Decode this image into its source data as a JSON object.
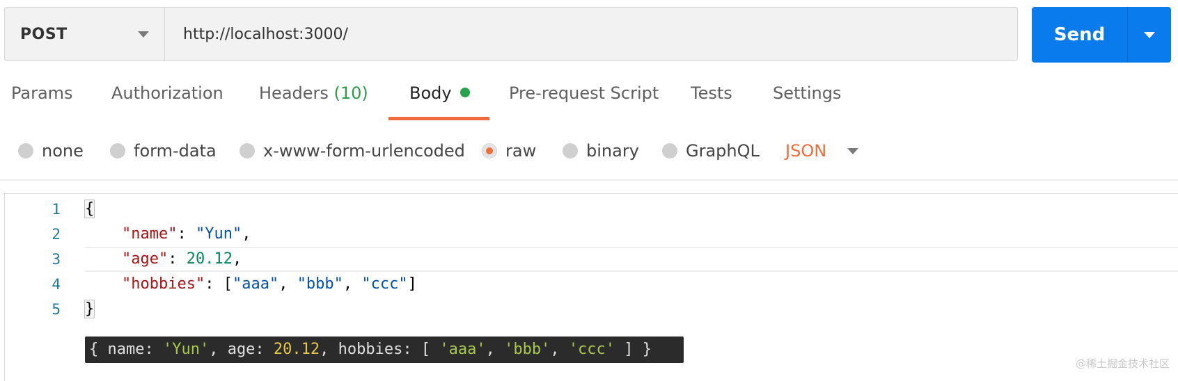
{
  "request": {
    "method": "POST",
    "url": "http://localhost:3000/",
    "send_label": "Send"
  },
  "tabs": [
    {
      "label": "Params"
    },
    {
      "label": "Authorization"
    },
    {
      "label": "Headers",
      "count": "(10)"
    },
    {
      "label": "Body",
      "active": true
    },
    {
      "label": "Pre-request Script"
    },
    {
      "label": "Tests"
    },
    {
      "label": "Settings"
    }
  ],
  "body_types": {
    "options": [
      "none",
      "form-data",
      "x-www-form-urlencoded",
      "raw",
      "binary",
      "GraphQL"
    ],
    "selected": "raw",
    "format": "JSON"
  },
  "editor": {
    "line_numbers": [
      "1",
      "2",
      "3",
      "4",
      "5"
    ],
    "lines": {
      "l1": {
        "brace": "{"
      },
      "l2": {
        "key": "\"name\"",
        "colon": ": ",
        "value": "\"Yun\"",
        "comma": ","
      },
      "l3": {
        "key": "\"age\"",
        "colon": ": ",
        "value": "20.12",
        "comma": ","
      },
      "l4": {
        "key": "\"hobbies\"",
        "colon": ": ",
        "open": "[",
        "v1": "\"aaa\"",
        "sep1": ", ",
        "v2": "\"bbb\"",
        "sep2": ", ",
        "v3": "\"ccc\"",
        "close": "]"
      },
      "l5": {
        "brace": "}"
      }
    }
  },
  "console_output": {
    "open": "{ name: ",
    "name": "'Yun'",
    "mid1": ", age: ",
    "age": "20.12",
    "mid2": ", hobbies: [ ",
    "h1": "'aaa'",
    "sep1": ", ",
    "h2": "'bbb'",
    "sep2": ", ",
    "h3": "'ccc'",
    "close": " ] }"
  },
  "colors": {
    "send": "#097bed",
    "active_tab_underline": "#f26b3a",
    "body_status_dot": "#26a34c",
    "headers_count": "#2a9d46",
    "format": "#f26b3a"
  },
  "watermark": "@稀土掘金技术社区"
}
